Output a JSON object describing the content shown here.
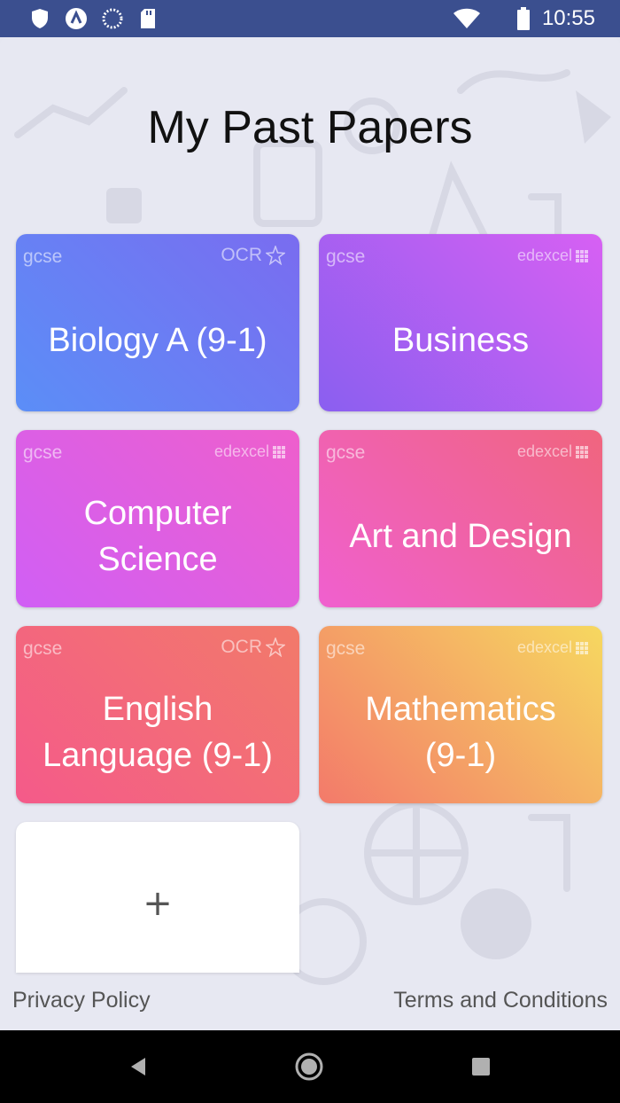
{
  "status_bar": {
    "time": "10:55",
    "icons": [
      "shield-icon",
      "app-a-icon",
      "sync-icon",
      "sd-card-icon",
      "wifi-icon",
      "battery-icon"
    ]
  },
  "page": {
    "title": "My Past Papers"
  },
  "cards": [
    {
      "level": "gcse",
      "board": "OCR",
      "title_lines": [
        "Biology A (9-1)"
      ]
    },
    {
      "level": "gcse",
      "board": "edexcel",
      "title_lines": [
        "Business"
      ]
    },
    {
      "level": "gcse",
      "board": "edexcel",
      "title_lines": [
        "Computer",
        "Science"
      ]
    },
    {
      "level": "gcse",
      "board": "edexcel",
      "title_lines": [
        "Art and Design"
      ]
    },
    {
      "level": "gcse",
      "board": "OCR",
      "title_lines": [
        "English",
        "Language (9-1)"
      ]
    },
    {
      "level": "gcse",
      "board": "edexcel",
      "title_lines": [
        "Mathematics",
        "(9-1)"
      ]
    }
  ],
  "add_card": {
    "label": "+"
  },
  "footer": {
    "privacy": "Privacy Policy",
    "terms": "Terms and Conditions"
  },
  "colors": {
    "status_bar": "#3b4f8f",
    "background": "#e7e8f2",
    "nav_bar": "#000000"
  }
}
